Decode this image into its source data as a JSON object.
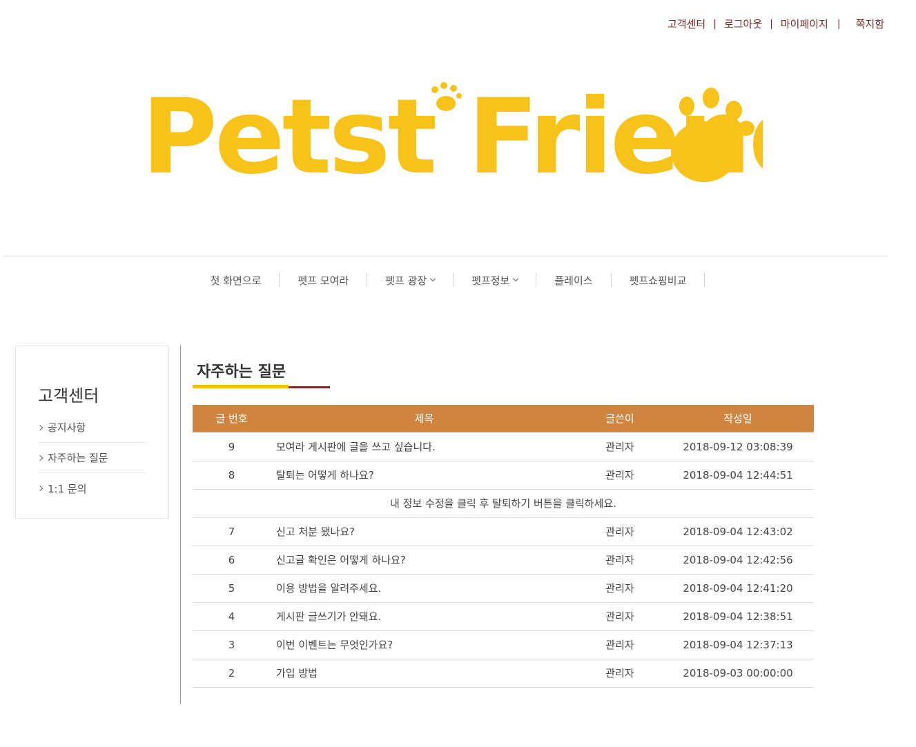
{
  "util_links": {
    "support": "고객센터",
    "logout": "로그아웃",
    "mypage": "마이페이지",
    "inbox": "쪽지함",
    "separator": "|"
  },
  "logo": {
    "text": "Petst Friends",
    "color": "#f7c21a"
  },
  "nav": {
    "items": [
      {
        "label": "첫 화면으로",
        "has_dropdown": false
      },
      {
        "label": "펫프 모여라",
        "has_dropdown": false
      },
      {
        "label": "펫프 광장",
        "has_dropdown": true
      },
      {
        "label": "펫프정보",
        "has_dropdown": true
      },
      {
        "label": "플레이스",
        "has_dropdown": false
      },
      {
        "label": "펫프쇼핑비교",
        "has_dropdown": false
      }
    ]
  },
  "sidebar": {
    "title": "고객센터",
    "items": [
      {
        "label": "공지사항"
      },
      {
        "label": "자주하는 질문"
      },
      {
        "label": "1:1 문의"
      }
    ]
  },
  "content": {
    "title": "자주하는 질문",
    "table": {
      "headers": {
        "num": "글 번호",
        "subject": "제목",
        "writer": "글쓴이",
        "date": "작성일"
      },
      "rows": [
        {
          "num": "9",
          "subject": "모여라 게시판에 글을 쓰고 싶습니다.",
          "writer": "관리자",
          "date": "2018-09-12 03:08:39"
        },
        {
          "num": "8",
          "subject": "탈퇴는 어떻게 하나요?",
          "writer": "관리자",
          "date": "2018-09-04 12:44:51",
          "answer": "내 정보 수정을 클릭 후 탈퇴하기 버튼을 클릭하세요."
        },
        {
          "num": "7",
          "subject": "신고 처분 됐나요?",
          "writer": "관리자",
          "date": "2018-09-04 12:43:02"
        },
        {
          "num": "6",
          "subject": "신고글 확인은 어떻게 하나요?",
          "writer": "관리자",
          "date": "2018-09-04 12:42:56"
        },
        {
          "num": "5",
          "subject": "이용 방법을 알려주세요.",
          "writer": "관리자",
          "date": "2018-09-04 12:41:20"
        },
        {
          "num": "4",
          "subject": "게시판 글쓰기가 안돼요.",
          "writer": "관리자",
          "date": "2018-09-04 12:38:51"
        },
        {
          "num": "3",
          "subject": "이번 이벤트는 무엇인가요?",
          "writer": "관리자",
          "date": "2018-09-04 12:37:13"
        },
        {
          "num": "2",
          "subject": "가입 방법",
          "writer": "관리자",
          "date": "2018-09-03 00:00:00"
        }
      ]
    }
  },
  "colors": {
    "header_bg": "#cf8540",
    "accent_dark": "#7a2a2a",
    "accent_yellow": "#f2c100"
  }
}
